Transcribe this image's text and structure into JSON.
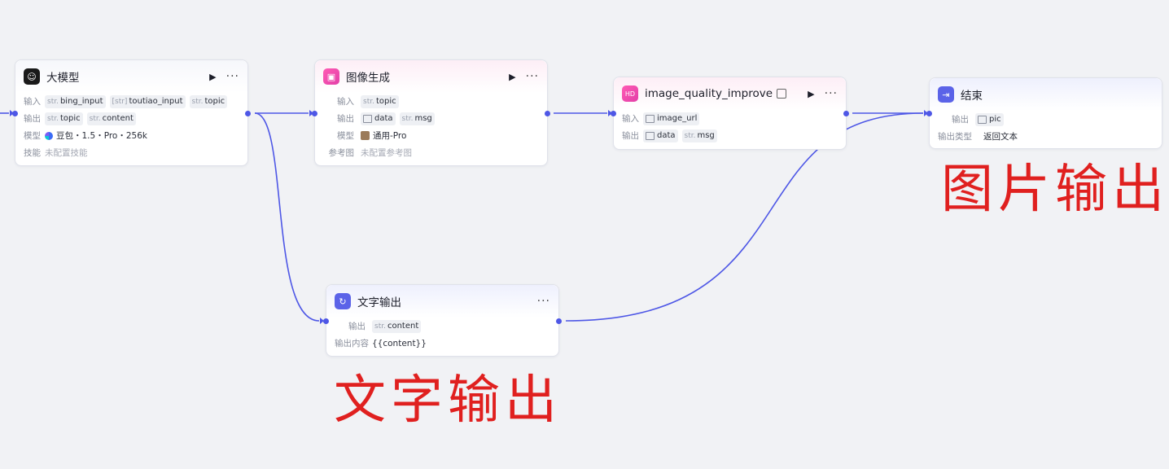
{
  "colors": {
    "edge": "#4e57e6",
    "accent_pink": "#e23fa8",
    "accent_blue": "#5b63e8",
    "annotation_red": "#e0201f"
  },
  "llm_node": {
    "icon": "robot-icon",
    "title": "大模型",
    "input_label": "输入",
    "inputs": [
      {
        "type": "str.",
        "name": "bing_input"
      },
      {
        "type": "[str]",
        "name": "toutiao_input"
      },
      {
        "type": "str.",
        "name": "topic"
      }
    ],
    "output_label": "输出",
    "outputs": [
      {
        "type": "str.",
        "name": "topic"
      },
      {
        "type": "str.",
        "name": "content"
      }
    ],
    "model_label": "模型",
    "model_value": "豆包・1.5・Pro・256k",
    "skill_label": "技能",
    "skill_value": "未配置技能"
  },
  "image_node": {
    "icon": "image-icon",
    "title": "图像生成",
    "input_label": "输入",
    "inputs": [
      {
        "type": "str.",
        "name": "topic"
      }
    ],
    "output_label": "输出",
    "outputs": [
      {
        "type": "img",
        "name": "data"
      },
      {
        "type": "str.",
        "name": "msg"
      }
    ],
    "model_label": "模型",
    "model_value": "通用-Pro",
    "ref_label": "参考图",
    "ref_value": "未配置参考图"
  },
  "quality_node": {
    "icon": "hd-icon",
    "title": "image_quality_improve",
    "input_label": "输入",
    "inputs": [
      {
        "type": "img",
        "name": "image_url"
      }
    ],
    "output_label": "输出",
    "outputs": [
      {
        "type": "img",
        "name": "data"
      },
      {
        "type": "str.",
        "name": "msg"
      }
    ]
  },
  "end_node": {
    "icon": "exit-icon",
    "title": "结束",
    "output_label": "输出",
    "outputs": [
      {
        "type": "img",
        "name": "pic"
      }
    ],
    "type_label": "输出类型",
    "type_value": "返回文本"
  },
  "text_node": {
    "icon": "loop-icon",
    "title": "文字输出",
    "output_label": "输出",
    "outputs": [
      {
        "type": "str.",
        "name": "content"
      }
    ],
    "content_label": "输出内容",
    "content_value": "{{content}}"
  },
  "annotations": {
    "picture_output": "图片输出",
    "text_output": "文字输出"
  }
}
